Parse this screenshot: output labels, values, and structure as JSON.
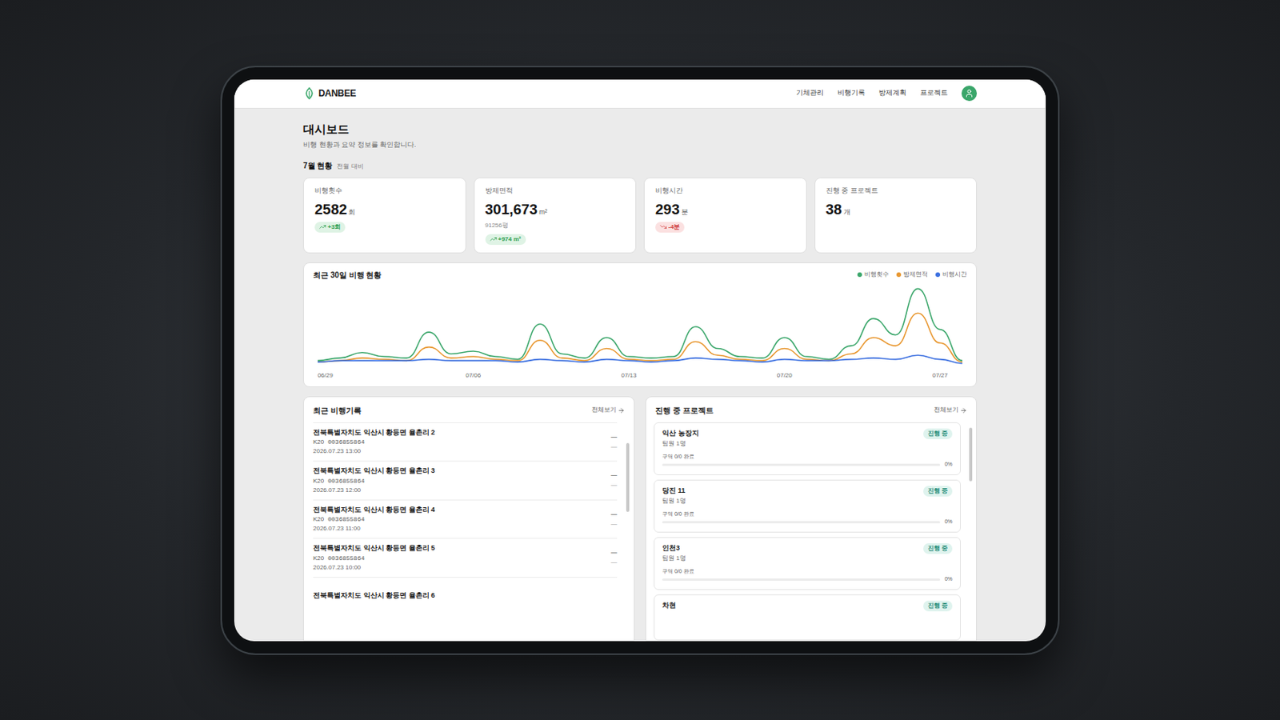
{
  "app": {
    "logo": "DANBEE",
    "nav": [
      "기체관리",
      "비행기록",
      "방제계획",
      "프로젝트"
    ]
  },
  "page": {
    "title": "대시보드",
    "subtitle": "비행 현황과 요약 정보를 확인합니다."
  },
  "summary": {
    "title": "7월 현황",
    "note": "전월 대비",
    "cards": [
      {
        "label": "비행횟수",
        "value": "2582",
        "unit": "회",
        "sub": "",
        "badge": "+3회",
        "trend": "up"
      },
      {
        "label": "방제면적",
        "value": "301,673",
        "unit": "m²",
        "sub": "91256평",
        "badge": "+974 m²",
        "trend": "up"
      },
      {
        "label": "비행시간",
        "value": "293",
        "unit": "분",
        "sub": "",
        "badge": "-4분",
        "trend": "down"
      },
      {
        "label": "진행 중 프로젝트",
        "value": "38",
        "unit": "개",
        "sub": "",
        "badge": "",
        "trend": "none"
      }
    ]
  },
  "chart": {
    "title": "최근 30일 비행 현황",
    "ticks": [
      {
        "label": "06/29",
        "index": 0
      },
      {
        "label": "07/06",
        "index": 7
      },
      {
        "label": "07/13",
        "index": 14
      },
      {
        "label": "07/20",
        "index": 21
      },
      {
        "label": "07/27",
        "index": 28
      }
    ],
    "series": [
      {
        "name": "비행횟수",
        "color": "#3aa66a",
        "values": [
          3,
          5,
          9,
          6,
          5,
          24,
          8,
          10,
          6,
          4,
          30,
          8,
          5,
          20,
          6,
          5,
          6,
          28,
          12,
          6,
          5,
          20,
          6,
          4,
          14,
          34,
          22,
          56,
          26,
          3
        ]
      },
      {
        "name": "방제면적",
        "color": "#e8962e",
        "values": [
          2,
          3,
          5,
          4,
          3,
          13,
          5,
          6,
          4,
          3,
          18,
          5,
          3,
          12,
          4,
          3,
          4,
          17,
          7,
          4,
          3,
          12,
          4,
          3,
          8,
          20,
          14,
          38,
          16,
          2
        ]
      },
      {
        "name": "비행시간",
        "color": "#3b6fe0",
        "values": [
          2,
          3,
          3,
          3,
          3,
          4,
          3,
          3,
          3,
          2,
          4,
          3,
          2,
          4,
          3,
          2,
          3,
          5,
          4,
          3,
          2,
          4,
          3,
          3,
          4,
          5,
          4,
          7,
          4,
          1
        ]
      }
    ]
  },
  "records": {
    "title": "최근 비행기록",
    "more": "전체보기",
    "items": [
      {
        "place": "전북특별자치도 익산시 황등면 율촌리 2",
        "model": "K20",
        "serial": "0036855864",
        "time": "2026.07.23 13:00",
        "marks": [
          "—",
          "—"
        ]
      },
      {
        "place": "전북특별자치도 익산시 황등면 율촌리 3",
        "model": "K20",
        "serial": "0036855864",
        "time": "2026.07.23 12:00",
        "marks": [
          "—",
          "—"
        ]
      },
      {
        "place": "전북특별자치도 익산시 황등면 율촌리 4",
        "model": "K20",
        "serial": "0036855864",
        "time": "2026.07.23 11:00",
        "marks": [
          "—",
          "—"
        ]
      },
      {
        "place": "전북특별자치도 익산시 황등면 율촌리 5",
        "model": "K20",
        "serial": "0036855864",
        "time": "2026.07.23 10:00",
        "marks": [
          "—",
          "—"
        ]
      },
      {
        "place": "전북특별자치도 익산시 황등면 율촌리 6",
        "model": "",
        "serial": "",
        "time": "",
        "marks": []
      }
    ]
  },
  "projects": {
    "title": "진행 중 프로젝트",
    "more": "전체보기",
    "items": [
      {
        "name": "익산 농장지",
        "members": "팀원 1명",
        "status": "진행 중",
        "areas": "구역 0/0 완료",
        "percent": "0%",
        "level": 0
      },
      {
        "name": "당진 11",
        "members": "팀원 1명",
        "status": "진행 중",
        "areas": "구역 0/0 완료",
        "percent": "0%",
        "level": 0
      },
      {
        "name": "인천3",
        "members": "팀원 1명",
        "status": "진행 중",
        "areas": "구역 0/0 완료",
        "percent": "0%",
        "level": 0
      },
      {
        "name": "차현",
        "members": "",
        "status": "진행 중",
        "areas": "",
        "percent": "",
        "level": 0
      }
    ]
  }
}
